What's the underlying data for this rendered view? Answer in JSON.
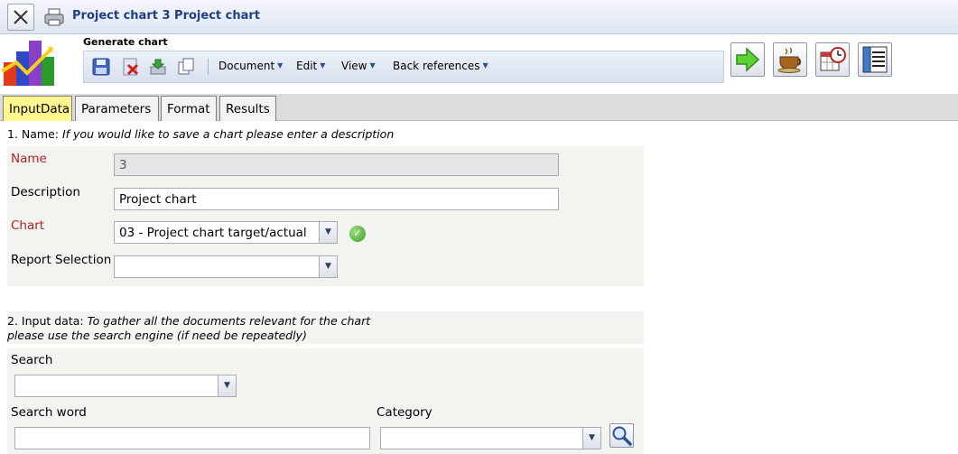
{
  "window": {
    "title": "Project chart 3 Project chart"
  },
  "header": {
    "section_label": "Generate chart",
    "menus": [
      {
        "label": "Document"
      },
      {
        "label": "Edit"
      },
      {
        "label": "View"
      },
      {
        "label": "Back references"
      }
    ],
    "icons": [
      "save-icon",
      "delete-icon",
      "import-icon",
      "copy-icon"
    ],
    "actions": [
      "run-arrow-icon",
      "coffee-cup-icon",
      "calendar-clock-icon",
      "report-list-icon"
    ]
  },
  "tabs": [
    {
      "label": "InputData",
      "active": true
    },
    {
      "label": "Parameters",
      "active": false
    },
    {
      "label": "Format",
      "active": false
    },
    {
      "label": "Results",
      "active": false
    }
  ],
  "section1": {
    "prefix": "1. Name: ",
    "hint": "If you would like to save a chart please enter a description",
    "name_label": "Name",
    "name_value": "3",
    "description_label": "Description",
    "description_value": "Project chart",
    "chart_label": "Chart",
    "chart_value": "03 - Project chart target/actual",
    "report_selection_label": "Report Selection",
    "report_selection_value": ""
  },
  "section2": {
    "prefix": "2. Input data: ",
    "hint_line1": "To gather all the documents relevant for the chart",
    "hint_line2": "please use the search engine (if need be repeatedly)",
    "search_label": "Search",
    "search_value": "",
    "search_word_label": "Search word",
    "search_word_value": "",
    "category_label": "Category",
    "category_value": ""
  }
}
